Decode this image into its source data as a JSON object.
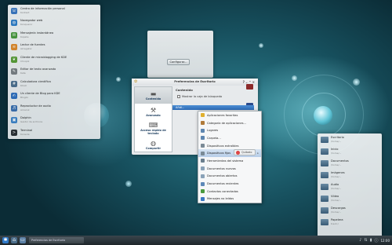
{
  "launcher": {
    "items": [
      {
        "title": "Centro de información personal",
        "subtitle": "Kontact",
        "icon": "kontact-icon",
        "color": "#3b78c2"
      },
      {
        "title": "Navegador web",
        "subtitle": "Konqueror",
        "icon": "globe-icon",
        "color": "#2f7ec9"
      },
      {
        "title": "Mensajería instantánea",
        "subtitle": "Kopete",
        "icon": "chat-icon",
        "color": "#4a9a3e"
      },
      {
        "title": "Lector de fuentes",
        "subtitle": "Akregator",
        "icon": "feed-icon",
        "color": "#e08a2a"
      },
      {
        "title": "Cliente de microblogging de KDE",
        "subtitle": "Choqok",
        "icon": "bird-icon",
        "color": "#5a9e36"
      },
      {
        "title": "Editor de texto avanzado",
        "subtitle": "Kate",
        "icon": "pencil-icon",
        "color": "#7a7f84"
      },
      {
        "title": "Calculadora científica",
        "subtitle": "KCalc",
        "icon": "calculator-icon",
        "color": "#4d6f8f"
      },
      {
        "title": "Un cliente de Blog para KDE",
        "subtitle": "Blogilo",
        "icon": "blog-icon",
        "color": "#2f6fbf"
      },
      {
        "title": "Reproductor de audio",
        "subtitle": "Amarok",
        "icon": "wolf-icon",
        "color": "#3c70b0"
      },
      {
        "title": "Dolphin",
        "subtitle": "Gestor de archivos",
        "icon": "dolphin-icon",
        "color": "#3d83c8"
      },
      {
        "title": "Terminal",
        "subtitle": "Konsole",
        "icon": "terminal-icon",
        "color": "#2c2f33"
      }
    ]
  },
  "config_widget": {
    "button_label": "Configurar..."
  },
  "prefs": {
    "title": "Preferencias de Escritorio",
    "sidebar": [
      {
        "label": "Contenido",
        "icon": "folder-icon",
        "selected": true
      },
      {
        "label": "Avanzado",
        "icon": "tools-icon",
        "selected": false
      },
      {
        "label": "Acceso rápido de teclado",
        "icon": "keyboard-icon",
        "selected": false
      },
      {
        "label": "Compartir",
        "icon": "globe-icon",
        "selected": false
      }
    ],
    "heading": "Contenido",
    "checkbox_label": "Mostrar la caja de búsqueda",
    "add_label": "Añdi..."
  },
  "menu": {
    "items": [
      {
        "label": "Aplicaciones favoritas",
        "icon": "star-icon",
        "color": "#e0b030",
        "submenu": false
      },
      {
        "label": "Categoría de aplicaciones...",
        "icon": "folder-icon",
        "color": "#b07a3a",
        "submenu": false
      },
      {
        "label": "Lugares",
        "icon": "folder-icon",
        "color": "#5e86b0",
        "submenu": false
      },
      {
        "label": "Carpeta...",
        "icon": "folder-icon",
        "color": "#5e86b0",
        "submenu": false
      },
      {
        "label": "Dispositivos extraíbles",
        "icon": "drive-icon",
        "color": "#7a8a96",
        "submenu": false
      },
      {
        "label": "Dispositivos fijos",
        "icon": "drive-icon",
        "color": "#7a8a96",
        "submenu": true
      },
      {
        "label": "Herramientas del sistema",
        "icon": "tools-icon",
        "color": "#6b7f8e",
        "submenu": false
      },
      {
        "label": "Documentos nuevos",
        "icon": "document-icon",
        "color": "#8aa2b8",
        "submenu": false
      },
      {
        "label": "Documentos abiertos",
        "icon": "document-icon",
        "color": "#8aa2b8",
        "submenu": false
      },
      {
        "label": "Documentos recientes",
        "icon": "clock-icon",
        "color": "#5d88b8",
        "submenu": false
      },
      {
        "label": "Contactos conectados",
        "icon": "contacts-icon",
        "color": "#4a9a3e",
        "submenu": false
      },
      {
        "label": "Mensajes no leídos",
        "icon": "mail-icon",
        "color": "#3b78c2",
        "submenu": false
      }
    ],
    "selected_index": 5,
    "tooltip": "Quitado"
  },
  "places": {
    "items": [
      {
        "title": "Escritorio",
        "subtitle": "/home/..."
      },
      {
        "title": "Inicio",
        "subtitle": "/home/..."
      },
      {
        "title": "Documentos",
        "subtitle": "/home/..."
      },
      {
        "title": "Imágenes",
        "subtitle": "/home/..."
      },
      {
        "title": "Audio",
        "subtitle": "/home/..."
      },
      {
        "title": "Vídeo",
        "subtitle": "/home/..."
      },
      {
        "title": "Descargas",
        "subtitle": "/home/..."
      },
      {
        "title": "Papelera",
        "subtitle": "trash:/"
      }
    ]
  },
  "taskbar": {
    "task_label": "Preferencias de Escritorio",
    "clock": "12:00"
  }
}
